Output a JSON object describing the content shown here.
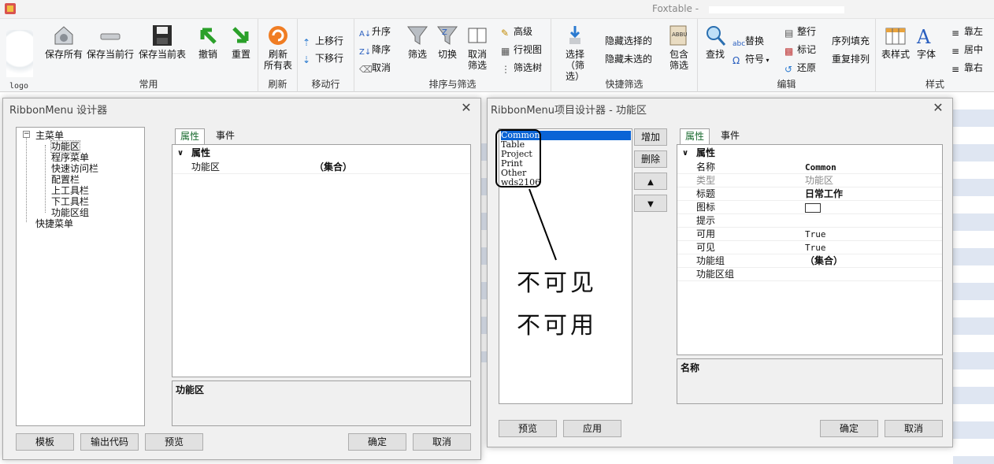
{
  "app_title": "Foxtable -",
  "logo_label": "logo",
  "ribbon": {
    "groups": {
      "common": "常用",
      "refresh": "刷新",
      "move_row": "移动行",
      "sort_filter": "排序与筛选",
      "quick_filter": "快捷筛选",
      "edit": "编辑",
      "style": "样式"
    },
    "buttons": {
      "save_all": "保存所有",
      "save_current_row": "保存当前行",
      "save_current_table": "保存当前表",
      "undo": "撤销",
      "reset": "重置",
      "refresh_all_1": "刷新",
      "refresh_all_2": "所有表",
      "move_up": "上移行",
      "move_down": "下移行",
      "sort_asc": "升序",
      "sort_desc": "降序",
      "cancel_sort": "取消",
      "filter": "筛选",
      "toggle": "切换",
      "cancel_filter_1": "取消",
      "cancel_filter_2": "筛选",
      "advanced": "高级",
      "row_view": "行视图",
      "filter_tree": "筛选树",
      "select_filter_1": "选择",
      "select_filter_2": "（筛选",
      "hide_selected": "隐藏选择的",
      "hide_unselected": "隐藏未选的",
      "include_filter_1": "包含",
      "include_filter_2": "筛选",
      "find": "查找",
      "replace": "替换",
      "symbol": "符号",
      "whole_row": "整行",
      "mark": "标记",
      "restore": "还原",
      "seq_fill": "序列填充",
      "repeat_arrange": "重复排列",
      "table_style": "表样式",
      "font": "字体",
      "align_left": "靠左",
      "align_center": "居中",
      "align_right": "靠右"
    }
  },
  "dialog1": {
    "title": "RibbonMenu 设计器",
    "tree": {
      "root": "主菜单",
      "children": [
        "功能区",
        "程序菜单",
        "快速访问栏",
        "配置栏",
        "上工具栏",
        "下工具栏",
        "功能区组"
      ],
      "root2": "快捷菜单"
    },
    "tabs": [
      "属性",
      "事件"
    ],
    "grid": {
      "category": "属性",
      "rows": [
        {
          "name": "功能区",
          "value": "（集合）"
        }
      ]
    },
    "desc_title": "功能区",
    "buttons": {
      "template": "模板",
      "export_code": "输出代码",
      "preview": "预览",
      "ok": "确定",
      "cancel": "取消"
    }
  },
  "dialog2": {
    "title": "RibbonMenu项目设计器 - 功能区",
    "list_items": [
      "Common",
      "Table",
      "Project",
      "Print",
      "Other",
      "wds2106"
    ],
    "side_buttons": {
      "add": "增加",
      "remove": "删除",
      "up_icon": "arrow-up",
      "down_icon": "arrow-down"
    },
    "annotation": {
      "line1": "不可见",
      "line2": "不可用"
    },
    "tabs": [
      "属性",
      "事件"
    ],
    "grid": {
      "category": "属性",
      "rows": [
        {
          "name": "名称",
          "value": "Common"
        },
        {
          "name": "类型",
          "value": "功能区"
        },
        {
          "name": "标题",
          "value": "日常工作"
        },
        {
          "name": "图标",
          "value": ""
        },
        {
          "name": "提示",
          "value": ""
        },
        {
          "name": "可用",
          "value": "True"
        },
        {
          "name": "可见",
          "value": "True"
        },
        {
          "name": "功能组",
          "value": "（集合）"
        },
        {
          "name": "功能区组",
          "value": ""
        }
      ]
    },
    "desc_title": "名称",
    "buttons": {
      "preview": "预览",
      "apply": "应用",
      "ok": "确定",
      "cancel": "取消"
    }
  },
  "colors": {
    "accent_green": "#1a6b2f",
    "selection_blue": "#0a64d6",
    "stripe_blue": "#dfe6f2"
  }
}
